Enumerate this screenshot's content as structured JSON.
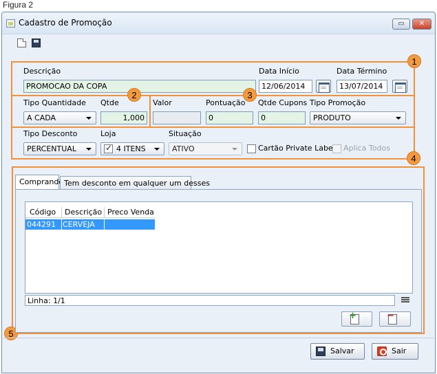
{
  "figure_caption": "Figura 2",
  "window": {
    "title": "Cadastro de Promoção"
  },
  "icons": {
    "app": "tag-app-icon",
    "new": "new-document-icon",
    "save": "floppy-disk-icon",
    "calendar": "calendar-icon",
    "add_row": "add-document-icon",
    "remove_row": "remove-document-icon",
    "menu": "hamburger-menu-icon",
    "exit": "power-icon"
  },
  "colors": {
    "callout": "#f1913c",
    "selected_row": "#3399ff",
    "green_field": "#e3f3e5"
  },
  "section1": {
    "descricao_label": "Descrição",
    "descricao_value": "PROMOCAO DA COPA",
    "data_inicio_label": "Data Início",
    "data_inicio_value": "12/06/2014",
    "data_termino_label": "Data Término",
    "data_termino_value": "13/07/2014"
  },
  "section2": {
    "tipo_quantidade_label": "Tipo Quantidade",
    "tipo_quantidade_value": "A CADA",
    "qtde_label": "Qtde",
    "qtde_value": "1,000"
  },
  "section3": {
    "valor_label": "Valor",
    "valor_value": "",
    "pontuacao_label": "Pontuação",
    "pontuacao_value": "0",
    "qtde_cupons_label": "Qtde Cupons",
    "qtde_cupons_value": "0",
    "tipo_promocao_label": "Tipo Promoção",
    "tipo_promocao_value": "PRODUTO"
  },
  "section4": {
    "tipo_desconto_label": "Tipo Desconto",
    "tipo_desconto_value": "PERCENTUAL",
    "loja_label": "Loja",
    "loja_value": "4 ITENS",
    "situacao_label": "Situação",
    "situacao_value": "ATIVO",
    "cartao_label": "Cartão Private Label",
    "cartao_checked": false,
    "aplica_label": "Aplica Todos",
    "aplica_checked": false
  },
  "callouts": [
    "1",
    "2",
    "3",
    "4",
    "5"
  ],
  "tabs": [
    {
      "label": "Comprando",
      "active": true
    },
    {
      "label": "Tem desconto em qualquer um desses",
      "active": false
    }
  ],
  "table": {
    "columns": [
      "Código",
      "Descrição",
      "Preco Venda"
    ],
    "rows": [
      {
        "codigo": "044291",
        "descricao": "CERVEJA",
        "preco": ""
      }
    ]
  },
  "status": {
    "linha": "Linha: 1/1"
  },
  "footer": {
    "save_label": "Salvar",
    "exit_label": "Sair"
  }
}
